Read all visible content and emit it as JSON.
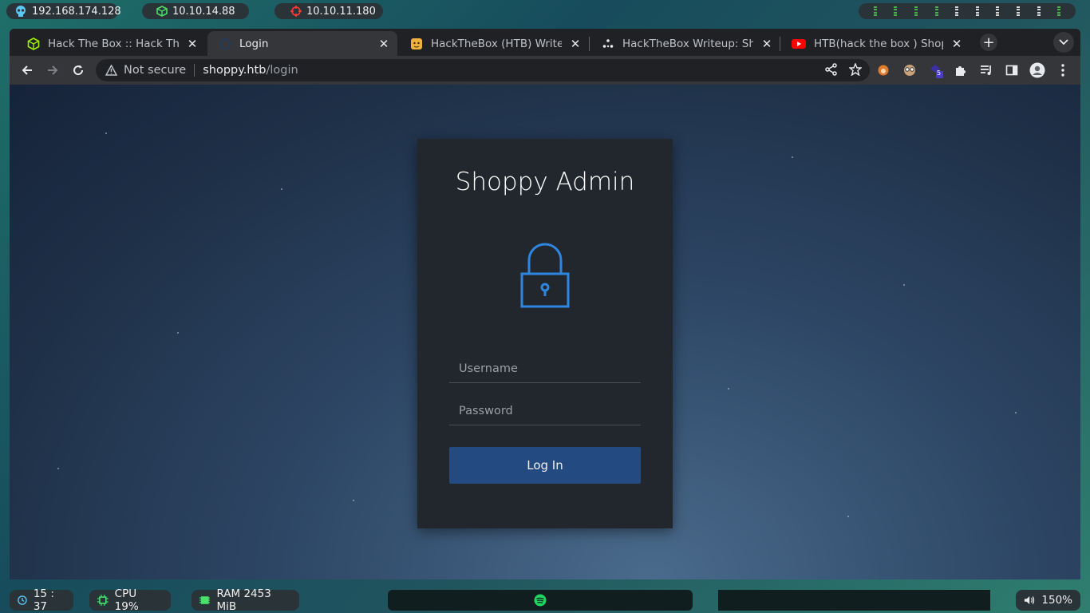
{
  "system_bar": {
    "ip_local": "192.168.174.128",
    "ip_vpn": "10.10.14.88",
    "ip_target": "10.10.11.180"
  },
  "browser": {
    "tabs": [
      {
        "label": "Hack The Box :: Hack The B",
        "icon": "htb-cube-icon",
        "active": false
      },
      {
        "label": "Login",
        "icon": "page-globe-icon",
        "active": true
      },
      {
        "label": "HackTheBox (HTB) Writeup",
        "icon": "cat-avatar-icon",
        "active": false
      },
      {
        "label": "HackTheBox Writeup: Shop",
        "icon": "dots-icon",
        "active": false
      },
      {
        "label": "HTB(hack the box ) Shoppy",
        "icon": "youtube-icon",
        "active": false
      }
    ],
    "address": {
      "security_label": "Not secure",
      "host": "shoppy.htb",
      "path": "/login"
    },
    "extension_badge": "5"
  },
  "login": {
    "title": "Shoppy Admin",
    "username_placeholder": "Username",
    "password_placeholder": "Password",
    "submit_label": "Log In"
  },
  "bottom_bar": {
    "clock": "15 : 37",
    "cpu": "CPU 19%",
    "ram": "RAM 2453 MiB",
    "volume": "150%"
  },
  "colors": {
    "accent_button": "#234a81",
    "lock_icon": "#2f86e0",
    "workspace_dots": "#4caf50"
  }
}
